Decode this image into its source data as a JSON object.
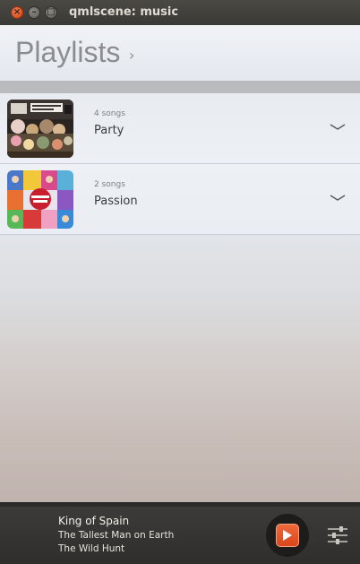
{
  "window": {
    "title": "qmlscene: music",
    "close_glyph": "×",
    "minimize_glyph": "–",
    "maximize_glyph": "□"
  },
  "header": {
    "title": "Playlists",
    "chevron": "›"
  },
  "playlists": [
    {
      "count": "4 songs",
      "name": "Party",
      "cover": "album-art-party",
      "expand_icon": "chevron-down-icon"
    },
    {
      "count": "2 songs",
      "name": "Passion",
      "cover": "album-art-passion",
      "expand_icon": "chevron-down-icon"
    }
  ],
  "player": {
    "title": "King of Spain",
    "artist": "The Tallest Man on Earth",
    "album": "The Wild Hunt",
    "progress": 0.0,
    "play_icon": "play-icon",
    "queue_icon": "equalizer-icon"
  },
  "colors": {
    "accent": "#e3572a",
    "player_bg": "#333230",
    "titlebar": "#3e3d39"
  }
}
